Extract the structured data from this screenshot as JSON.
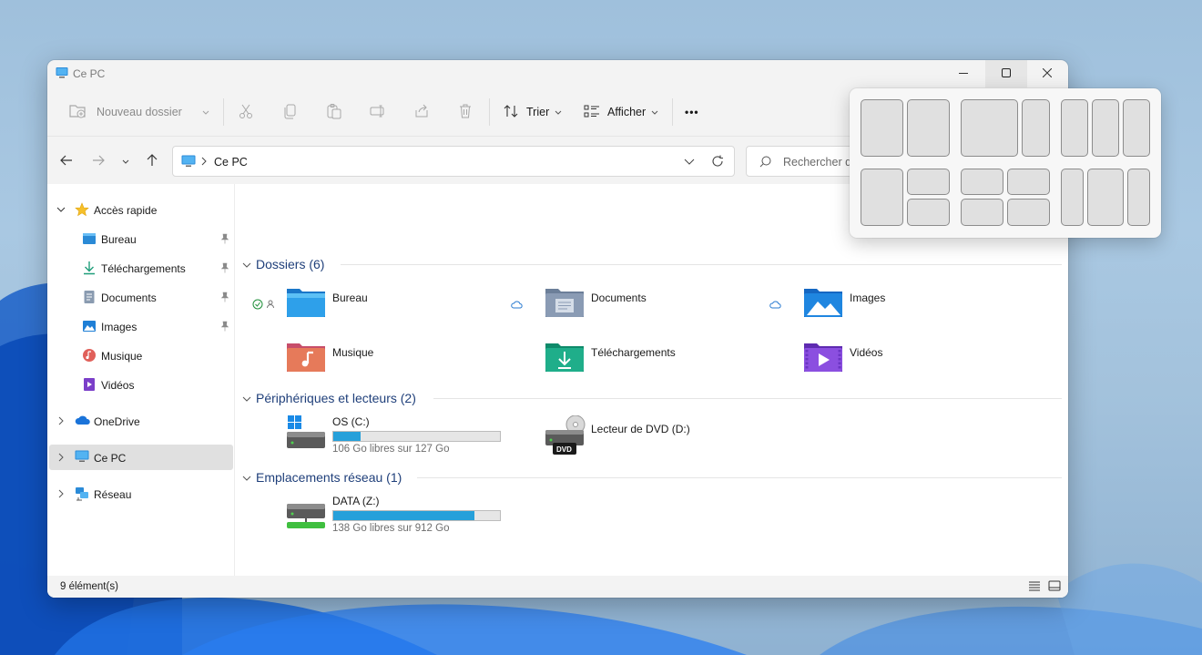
{
  "window": {
    "title": "Ce PC",
    "title_icon": "computer-icon"
  },
  "toolbar": {
    "new_folder": "Nouveau dossier",
    "sort": "Trier",
    "view": "Afficher",
    "more": "•••"
  },
  "address": {
    "path": "Ce PC",
    "search_placeholder": "Rechercher dans : Ce PC"
  },
  "sidebar": {
    "items": [
      {
        "label": "Accès rapide",
        "icon": "star-icon"
      },
      {
        "label": "Bureau",
        "icon": "desktop-folder-icon",
        "pinned": true
      },
      {
        "label": "Téléchargements",
        "icon": "download-icon",
        "pinned": true
      },
      {
        "label": "Documents",
        "icon": "document-icon",
        "pinned": true
      },
      {
        "label": "Images",
        "icon": "image-icon",
        "pinned": true
      },
      {
        "label": "Musique",
        "icon": "music-icon"
      },
      {
        "label": "Vidéos",
        "icon": "video-icon"
      },
      {
        "label": "OneDrive",
        "icon": "onedrive-icon"
      },
      {
        "label": "Ce PC",
        "icon": "computer-icon",
        "selected": true
      },
      {
        "label": "Réseau",
        "icon": "network-icon"
      }
    ]
  },
  "groups": {
    "folders": "Dossiers (6)",
    "devices": "Périphériques et lecteurs (2)",
    "network": "Emplacements réseau (1)"
  },
  "folders": [
    {
      "label": "Bureau",
      "icon": "desktop-folder-icon"
    },
    {
      "label": "Documents",
      "icon": "documents-folder-icon"
    },
    {
      "label": "Images",
      "icon": "images-folder-icon"
    },
    {
      "label": "Musique",
      "icon": "music-folder-icon"
    },
    {
      "label": "Téléchargements",
      "icon": "downloads-folder-icon"
    },
    {
      "label": "Vidéos",
      "icon": "videos-folder-icon"
    }
  ],
  "drives": [
    {
      "name": "OS (C:)",
      "free": "106 Go libres sur 127 Go",
      "used_fraction": 0.165
    },
    {
      "name": "Lecteur de DVD (D:)",
      "badge": "DVD"
    }
  ],
  "network_locations": [
    {
      "name": "DATA (Z:)",
      "free": "138 Go libres sur 912 Go",
      "used_fraction": 0.849
    }
  ],
  "status": {
    "count": "9 élément(s)"
  },
  "colors": {
    "accent": "#26a0da",
    "group_heading": "#1f3f7a"
  }
}
